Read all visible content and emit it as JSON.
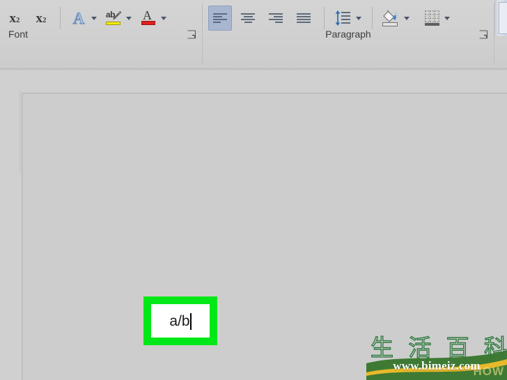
{
  "ribbon": {
    "font_group": {
      "label": "Font",
      "dialog_launcher_name": "font-dialog-launcher",
      "buttons": [
        {
          "name": "subscript-button",
          "glyph_base": "x",
          "glyph_script": "2",
          "kind": "sub",
          "tooltip": "Subscript"
        },
        {
          "name": "superscript-button",
          "glyph_base": "x",
          "glyph_script": "2",
          "kind": "sup",
          "tooltip": "Superscript"
        },
        {
          "name": "text-effects-button",
          "glyph_base": "A",
          "tooltip": "Text Effects"
        },
        {
          "name": "text-highlight-color-button",
          "glyph_base": "ab",
          "swatch": "#f2e90a",
          "tooltip": "Text Highlight Color"
        },
        {
          "name": "font-color-button",
          "glyph_base": "A",
          "swatch": "#e02020",
          "tooltip": "Font Color"
        }
      ]
    },
    "paragraph_group": {
      "label": "Paragraph",
      "dialog_launcher_name": "paragraph-dialog-launcher",
      "buttons": [
        {
          "name": "align-left-button",
          "selected": true,
          "tooltip": "Align Left"
        },
        {
          "name": "align-center-button",
          "selected": false,
          "tooltip": "Center"
        },
        {
          "name": "align-right-button",
          "selected": false,
          "tooltip": "Align Right"
        },
        {
          "name": "justify-button",
          "selected": false,
          "tooltip": "Justify"
        },
        {
          "name": "line-spacing-button",
          "selected": false,
          "tooltip": "Line and Paragraph Spacing"
        },
        {
          "name": "shading-button",
          "selected": false,
          "tooltip": "Shading"
        },
        {
          "name": "borders-button",
          "selected": false,
          "tooltip": "Borders"
        }
      ]
    }
  },
  "document": {
    "textbox": {
      "value": "a/b",
      "border_color": "#00e818",
      "fill_color": "#ffffff",
      "caret_visible": true
    }
  },
  "watermark": {
    "cjk_chars": [
      "生",
      "活",
      "百",
      "科"
    ],
    "url": "www.bimeiz.com",
    "faint_text": "HOW",
    "banner_green": "#3e7a34",
    "banner_gold": "#e8b92a"
  },
  "colors": {
    "ribbon_bg": "#d0d0d0",
    "canvas_bg": "#cdcdcd",
    "selected_button": "#a8b6d0",
    "icon_gray": "#5e6a7c",
    "accent_blue": "#2f6fb5"
  }
}
